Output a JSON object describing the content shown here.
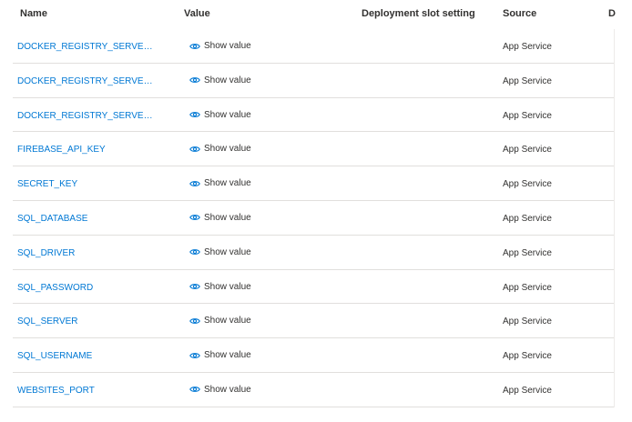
{
  "columns": {
    "name": "Name",
    "value": "Value",
    "slot": "Deployment slot setting",
    "source": "Source",
    "extra": "D"
  },
  "show_value_label": "Show value",
  "rows": [
    {
      "name": "DOCKER_REGISTRY_SERVER_P...",
      "source": "App Service"
    },
    {
      "name": "DOCKER_REGISTRY_SERVER_U...",
      "source": "App Service"
    },
    {
      "name": "DOCKER_REGISTRY_SERVER_U...",
      "source": "App Service"
    },
    {
      "name": "FIREBASE_API_KEY",
      "source": "App Service"
    },
    {
      "name": "SECRET_KEY",
      "source": "App Service"
    },
    {
      "name": "SQL_DATABASE",
      "source": "App Service"
    },
    {
      "name": "SQL_DRIVER",
      "source": "App Service"
    },
    {
      "name": "SQL_PASSWORD",
      "source": "App Service"
    },
    {
      "name": "SQL_SERVER",
      "source": "App Service"
    },
    {
      "name": "SQL_USERNAME",
      "source": "App Service"
    },
    {
      "name": "WEBSITES_PORT",
      "source": "App Service"
    }
  ],
  "colors": {
    "link": "#0078d4",
    "text": "#323130",
    "divider": "#e1dfdd"
  },
  "icons": {
    "show_value": "eye-icon"
  }
}
